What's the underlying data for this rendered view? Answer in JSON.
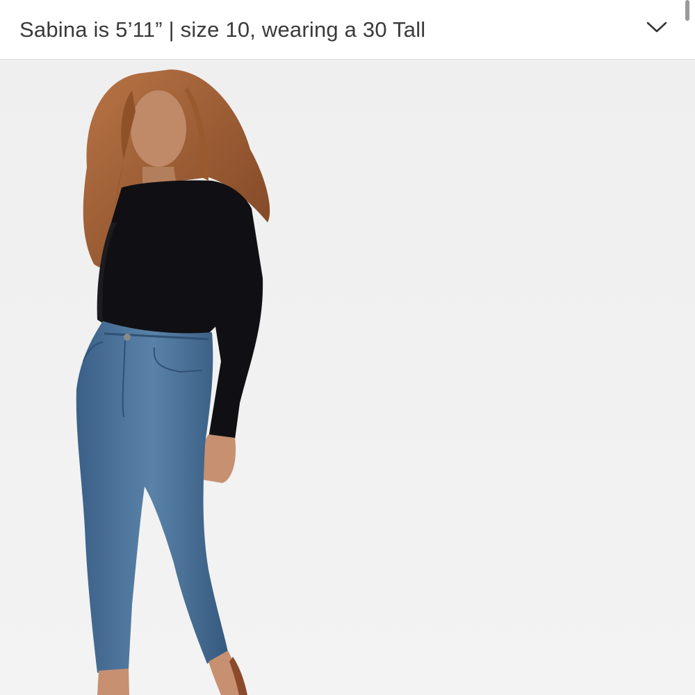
{
  "header": {
    "model_info": "Sabina is 5’11” | size 10, wearing a 30 Tall",
    "toggle_icon": "chevron-down-icon"
  },
  "product_photo": {
    "subject": "model-wearing-black-sweater-and-blue-jeans"
  },
  "colors": {
    "header_bg": "#ffffff",
    "text": "#3a3a3a",
    "photo_bg": "#f1f1f1",
    "sweater": "#0f0f12",
    "denim": "#3f6a92",
    "hair": "#a35f34"
  }
}
